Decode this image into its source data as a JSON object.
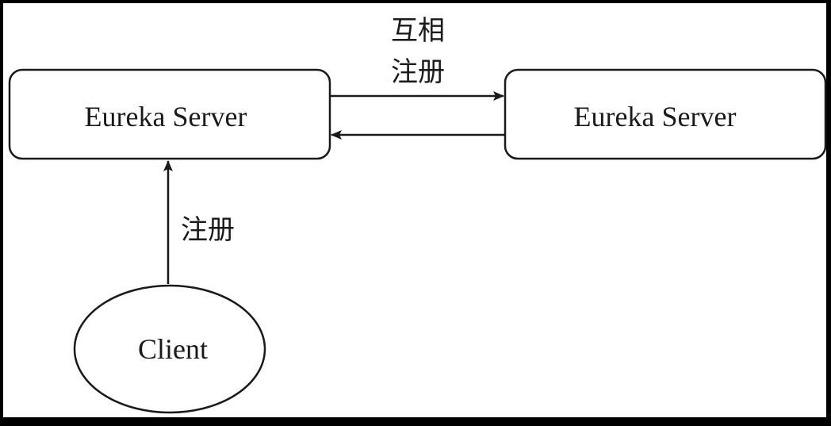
{
  "nodes": {
    "server_left": {
      "label": "Eureka Server"
    },
    "server_right": {
      "label": "Eureka Server"
    },
    "client": {
      "label": "Client"
    }
  },
  "edges": {
    "mutual_register": {
      "label_line1": "互相",
      "label_line2": "注册"
    },
    "client_register": {
      "label": "注册"
    }
  },
  "colors": {
    "frame": "#000000",
    "paper": "#ffffff",
    "ink": "#1a1a1a"
  }
}
